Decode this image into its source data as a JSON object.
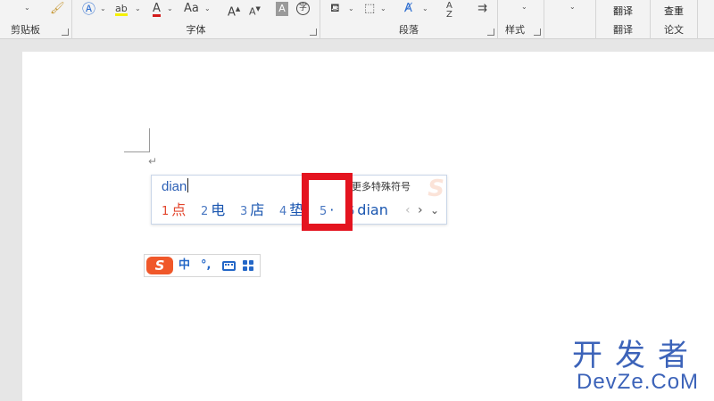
{
  "ribbon": {
    "groups": {
      "clipboard": "剪贴板",
      "font": "字体",
      "paragraph": "段落",
      "styles": "样式",
      "translate": "翻译",
      "paper": "论文"
    },
    "font_buttons": {
      "change_case": "Aa",
      "char_shading": "A",
      "enclose": "字"
    },
    "big_buttons": {
      "translate_label": "翻译",
      "check_label": "查重"
    }
  },
  "ime": {
    "input": "dian",
    "more_symbols": "更多特殊符号",
    "candidates": [
      {
        "num": "1",
        "text": "点"
      },
      {
        "num": "2",
        "text": "电"
      },
      {
        "num": "3",
        "text": "店"
      },
      {
        "num": "4",
        "text": "垫"
      },
      {
        "num": "5",
        "text": "·"
      },
      {
        "num": "6",
        "text": "dian"
      }
    ],
    "accent_color": "#e2442b"
  },
  "status_bar": {
    "logo": "S",
    "mode": "中",
    "punct": "°,"
  },
  "watermark": {
    "cn": "开发者",
    "en": "DevZe.CoM"
  },
  "highlight_color": "#e4141f"
}
